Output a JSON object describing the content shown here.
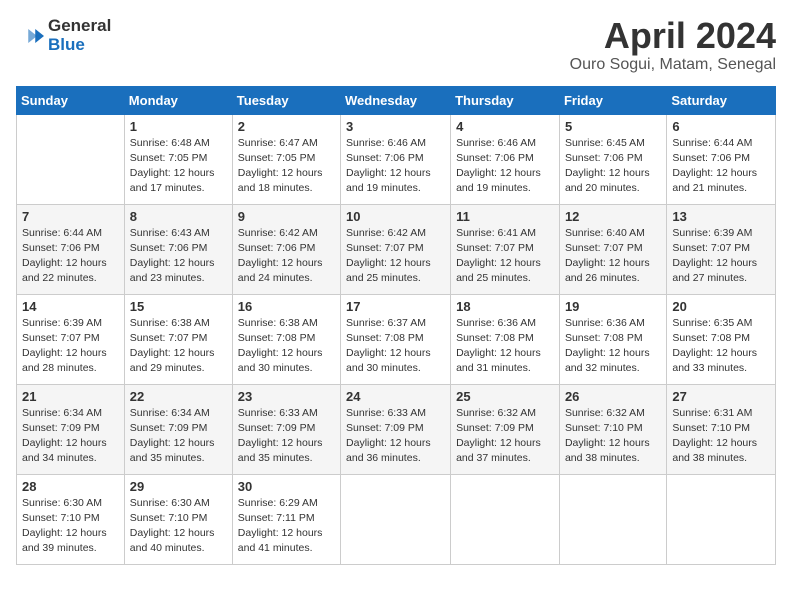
{
  "logo": {
    "line1": "General",
    "line2": "Blue"
  },
  "title": "April 2024",
  "subtitle": "Ouro Sogui, Matam, Senegal",
  "header_days": [
    "Sunday",
    "Monday",
    "Tuesday",
    "Wednesday",
    "Thursday",
    "Friday",
    "Saturday"
  ],
  "weeks": [
    [
      {
        "day": "",
        "sunrise": "",
        "sunset": "",
        "daylight": ""
      },
      {
        "day": "1",
        "sunrise": "Sunrise: 6:48 AM",
        "sunset": "Sunset: 7:05 PM",
        "daylight": "Daylight: 12 hours and 17 minutes."
      },
      {
        "day": "2",
        "sunrise": "Sunrise: 6:47 AM",
        "sunset": "Sunset: 7:05 PM",
        "daylight": "Daylight: 12 hours and 18 minutes."
      },
      {
        "day": "3",
        "sunrise": "Sunrise: 6:46 AM",
        "sunset": "Sunset: 7:06 PM",
        "daylight": "Daylight: 12 hours and 19 minutes."
      },
      {
        "day": "4",
        "sunrise": "Sunrise: 6:46 AM",
        "sunset": "Sunset: 7:06 PM",
        "daylight": "Daylight: 12 hours and 19 minutes."
      },
      {
        "day": "5",
        "sunrise": "Sunrise: 6:45 AM",
        "sunset": "Sunset: 7:06 PM",
        "daylight": "Daylight: 12 hours and 20 minutes."
      },
      {
        "day": "6",
        "sunrise": "Sunrise: 6:44 AM",
        "sunset": "Sunset: 7:06 PM",
        "daylight": "Daylight: 12 hours and 21 minutes."
      }
    ],
    [
      {
        "day": "7",
        "sunrise": "Sunrise: 6:44 AM",
        "sunset": "Sunset: 7:06 PM",
        "daylight": "Daylight: 12 hours and 22 minutes."
      },
      {
        "day": "8",
        "sunrise": "Sunrise: 6:43 AM",
        "sunset": "Sunset: 7:06 PM",
        "daylight": "Daylight: 12 hours and 23 minutes."
      },
      {
        "day": "9",
        "sunrise": "Sunrise: 6:42 AM",
        "sunset": "Sunset: 7:06 PM",
        "daylight": "Daylight: 12 hours and 24 minutes."
      },
      {
        "day": "10",
        "sunrise": "Sunrise: 6:42 AM",
        "sunset": "Sunset: 7:07 PM",
        "daylight": "Daylight: 12 hours and 25 minutes."
      },
      {
        "day": "11",
        "sunrise": "Sunrise: 6:41 AM",
        "sunset": "Sunset: 7:07 PM",
        "daylight": "Daylight: 12 hours and 25 minutes."
      },
      {
        "day": "12",
        "sunrise": "Sunrise: 6:40 AM",
        "sunset": "Sunset: 7:07 PM",
        "daylight": "Daylight: 12 hours and 26 minutes."
      },
      {
        "day": "13",
        "sunrise": "Sunrise: 6:39 AM",
        "sunset": "Sunset: 7:07 PM",
        "daylight": "Daylight: 12 hours and 27 minutes."
      }
    ],
    [
      {
        "day": "14",
        "sunrise": "Sunrise: 6:39 AM",
        "sunset": "Sunset: 7:07 PM",
        "daylight": "Daylight: 12 hours and 28 minutes."
      },
      {
        "day": "15",
        "sunrise": "Sunrise: 6:38 AM",
        "sunset": "Sunset: 7:07 PM",
        "daylight": "Daylight: 12 hours and 29 minutes."
      },
      {
        "day": "16",
        "sunrise": "Sunrise: 6:38 AM",
        "sunset": "Sunset: 7:08 PM",
        "daylight": "Daylight: 12 hours and 30 minutes."
      },
      {
        "day": "17",
        "sunrise": "Sunrise: 6:37 AM",
        "sunset": "Sunset: 7:08 PM",
        "daylight": "Daylight: 12 hours and 30 minutes."
      },
      {
        "day": "18",
        "sunrise": "Sunrise: 6:36 AM",
        "sunset": "Sunset: 7:08 PM",
        "daylight": "Daylight: 12 hours and 31 minutes."
      },
      {
        "day": "19",
        "sunrise": "Sunrise: 6:36 AM",
        "sunset": "Sunset: 7:08 PM",
        "daylight": "Daylight: 12 hours and 32 minutes."
      },
      {
        "day": "20",
        "sunrise": "Sunrise: 6:35 AM",
        "sunset": "Sunset: 7:08 PM",
        "daylight": "Daylight: 12 hours and 33 minutes."
      }
    ],
    [
      {
        "day": "21",
        "sunrise": "Sunrise: 6:34 AM",
        "sunset": "Sunset: 7:09 PM",
        "daylight": "Daylight: 12 hours and 34 minutes."
      },
      {
        "day": "22",
        "sunrise": "Sunrise: 6:34 AM",
        "sunset": "Sunset: 7:09 PM",
        "daylight": "Daylight: 12 hours and 35 minutes."
      },
      {
        "day": "23",
        "sunrise": "Sunrise: 6:33 AM",
        "sunset": "Sunset: 7:09 PM",
        "daylight": "Daylight: 12 hours and 35 minutes."
      },
      {
        "day": "24",
        "sunrise": "Sunrise: 6:33 AM",
        "sunset": "Sunset: 7:09 PM",
        "daylight": "Daylight: 12 hours and 36 minutes."
      },
      {
        "day": "25",
        "sunrise": "Sunrise: 6:32 AM",
        "sunset": "Sunset: 7:09 PM",
        "daylight": "Daylight: 12 hours and 37 minutes."
      },
      {
        "day": "26",
        "sunrise": "Sunrise: 6:32 AM",
        "sunset": "Sunset: 7:10 PM",
        "daylight": "Daylight: 12 hours and 38 minutes."
      },
      {
        "day": "27",
        "sunrise": "Sunrise: 6:31 AM",
        "sunset": "Sunset: 7:10 PM",
        "daylight": "Daylight: 12 hours and 38 minutes."
      }
    ],
    [
      {
        "day": "28",
        "sunrise": "Sunrise: 6:30 AM",
        "sunset": "Sunset: 7:10 PM",
        "daylight": "Daylight: 12 hours and 39 minutes."
      },
      {
        "day": "29",
        "sunrise": "Sunrise: 6:30 AM",
        "sunset": "Sunset: 7:10 PM",
        "daylight": "Daylight: 12 hours and 40 minutes."
      },
      {
        "day": "30",
        "sunrise": "Sunrise: 6:29 AM",
        "sunset": "Sunset: 7:11 PM",
        "daylight": "Daylight: 12 hours and 41 minutes."
      },
      {
        "day": "",
        "sunrise": "",
        "sunset": "",
        "daylight": ""
      },
      {
        "day": "",
        "sunrise": "",
        "sunset": "",
        "daylight": ""
      },
      {
        "day": "",
        "sunrise": "",
        "sunset": "",
        "daylight": ""
      },
      {
        "day": "",
        "sunrise": "",
        "sunset": "",
        "daylight": ""
      }
    ]
  ]
}
